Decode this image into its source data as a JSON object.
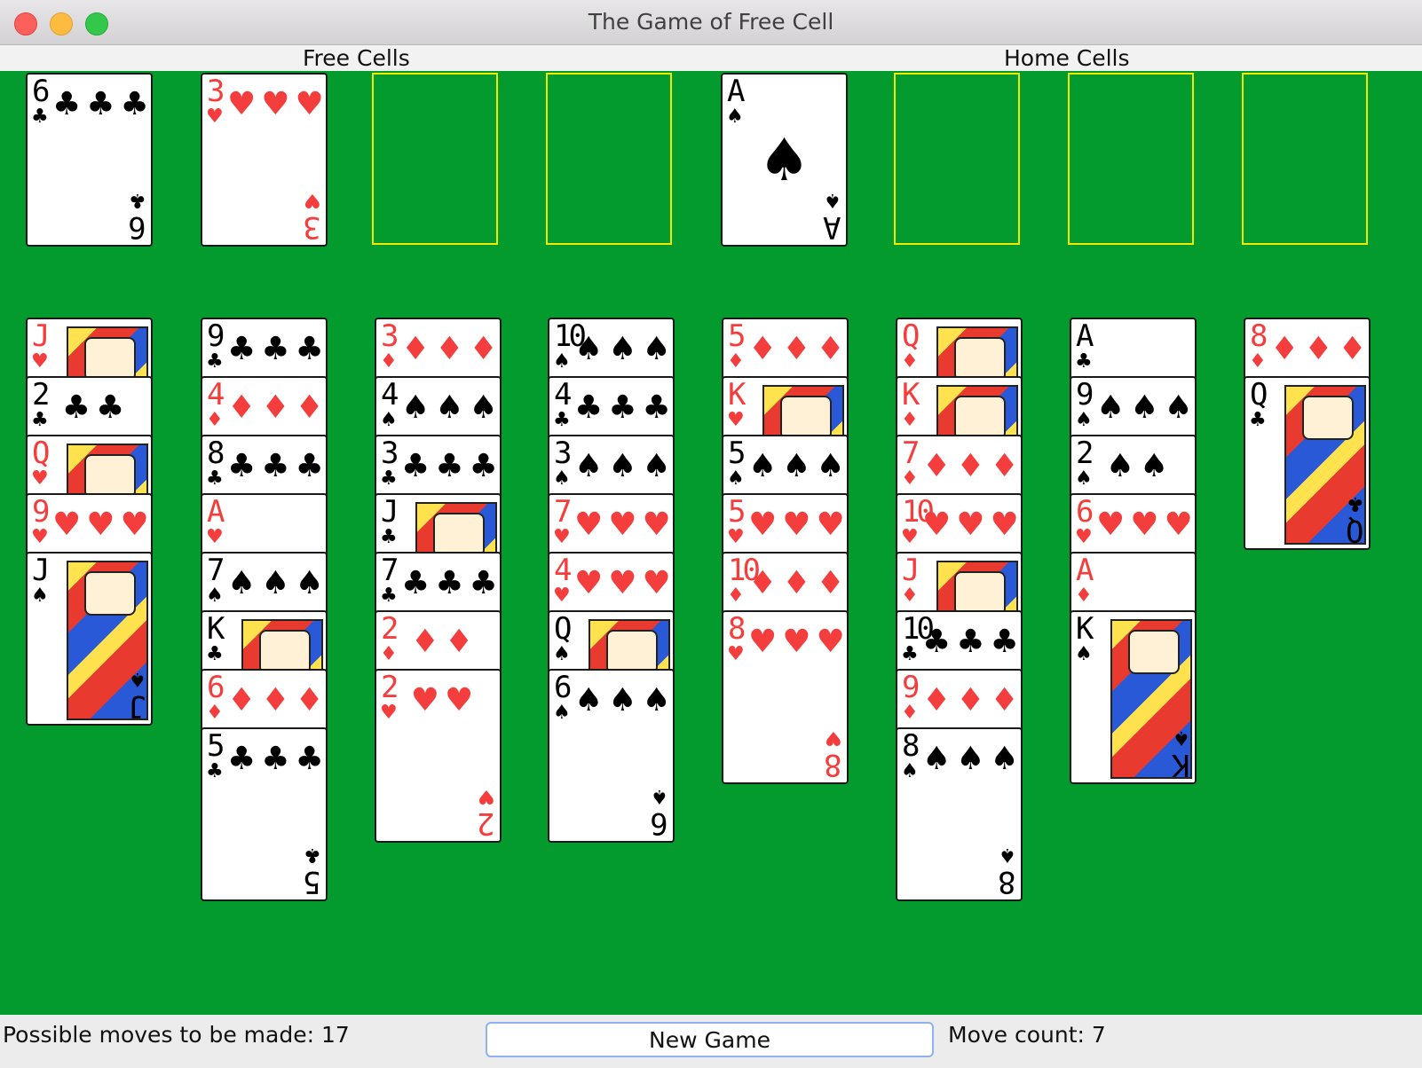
{
  "window": {
    "title": "The Game of Free Cell"
  },
  "headers": {
    "free_cells": "Free Cells",
    "home_cells": "Home Cells"
  },
  "free_cells": [
    {
      "rank": "6",
      "suit": "♣",
      "color": "black"
    },
    {
      "rank": "3",
      "suit": "♥",
      "color": "red"
    },
    null,
    null
  ],
  "home_cells": [
    {
      "rank": "A",
      "suit": "♠",
      "color": "black"
    },
    null,
    null,
    null
  ],
  "tableau": [
    [
      {
        "rank": "J",
        "suit": "♥",
        "color": "red"
      },
      {
        "rank": "2",
        "suit": "♣",
        "color": "black"
      },
      {
        "rank": "Q",
        "suit": "♥",
        "color": "red"
      },
      {
        "rank": "9",
        "suit": "♥",
        "color": "red"
      },
      {
        "rank": "J",
        "suit": "♠",
        "color": "black"
      }
    ],
    [
      {
        "rank": "9",
        "suit": "♣",
        "color": "black"
      },
      {
        "rank": "4",
        "suit": "♦",
        "color": "red"
      },
      {
        "rank": "8",
        "suit": "♣",
        "color": "black"
      },
      {
        "rank": "A",
        "suit": "♥",
        "color": "red"
      },
      {
        "rank": "7",
        "suit": "♠",
        "color": "black"
      },
      {
        "rank": "K",
        "suit": "♣",
        "color": "black"
      },
      {
        "rank": "6",
        "suit": "♦",
        "color": "red"
      },
      {
        "rank": "5",
        "suit": "♣",
        "color": "black"
      }
    ],
    [
      {
        "rank": "3",
        "suit": "♦",
        "color": "red"
      },
      {
        "rank": "4",
        "suit": "♠",
        "color": "black"
      },
      {
        "rank": "3",
        "suit": "♣",
        "color": "black"
      },
      {
        "rank": "J",
        "suit": "♣",
        "color": "black"
      },
      {
        "rank": "7",
        "suit": "♣",
        "color": "black"
      },
      {
        "rank": "2",
        "suit": "♦",
        "color": "red"
      },
      {
        "rank": "2",
        "suit": "♥",
        "color": "red"
      }
    ],
    [
      {
        "rank": "10",
        "suit": "♠",
        "color": "black"
      },
      {
        "rank": "4",
        "suit": "♣",
        "color": "black"
      },
      {
        "rank": "3",
        "suit": "♠",
        "color": "black"
      },
      {
        "rank": "7",
        "suit": "♥",
        "color": "red"
      },
      {
        "rank": "4",
        "suit": "♥",
        "color": "red"
      },
      {
        "rank": "Q",
        "suit": "♠",
        "color": "black"
      },
      {
        "rank": "6",
        "suit": "♠",
        "color": "black"
      }
    ],
    [
      {
        "rank": "5",
        "suit": "♦",
        "color": "red"
      },
      {
        "rank": "K",
        "suit": "♥",
        "color": "red"
      },
      {
        "rank": "5",
        "suit": "♠",
        "color": "black"
      },
      {
        "rank": "5",
        "suit": "♥",
        "color": "red"
      },
      {
        "rank": "10",
        "suit": "♦",
        "color": "red"
      },
      {
        "rank": "8",
        "suit": "♥",
        "color": "red"
      }
    ],
    [
      {
        "rank": "Q",
        "suit": "♦",
        "color": "red"
      },
      {
        "rank": "K",
        "suit": "♦",
        "color": "red"
      },
      {
        "rank": "7",
        "suit": "♦",
        "color": "red"
      },
      {
        "rank": "10",
        "suit": "♥",
        "color": "red"
      },
      {
        "rank": "J",
        "suit": "♦",
        "color": "red"
      },
      {
        "rank": "10",
        "suit": "♣",
        "color": "black"
      },
      {
        "rank": "9",
        "suit": "♦",
        "color": "red"
      },
      {
        "rank": "8",
        "suit": "♠",
        "color": "black"
      }
    ],
    [
      {
        "rank": "A",
        "suit": "♣",
        "color": "black"
      },
      {
        "rank": "9",
        "suit": "♠",
        "color": "black"
      },
      {
        "rank": "2",
        "suit": "♠",
        "color": "black"
      },
      {
        "rank": "6",
        "suit": "♥",
        "color": "red"
      },
      {
        "rank": "A",
        "suit": "♦",
        "color": "red"
      },
      {
        "rank": "K",
        "suit": "♠",
        "color": "black"
      }
    ],
    [
      {
        "rank": "8",
        "suit": "♦",
        "color": "red"
      },
      {
        "rank": "Q",
        "suit": "♣",
        "color": "black"
      }
    ]
  ],
  "status": {
    "possible_moves": "Possible moves to be made: 17",
    "new_game_label": "New Game",
    "move_count": "Move count: 7"
  },
  "colors": {
    "felt": "#039b2d",
    "empty_slot_border": "#f3e800",
    "red_suit": "#f43d3d",
    "black_suit": "#000000"
  }
}
